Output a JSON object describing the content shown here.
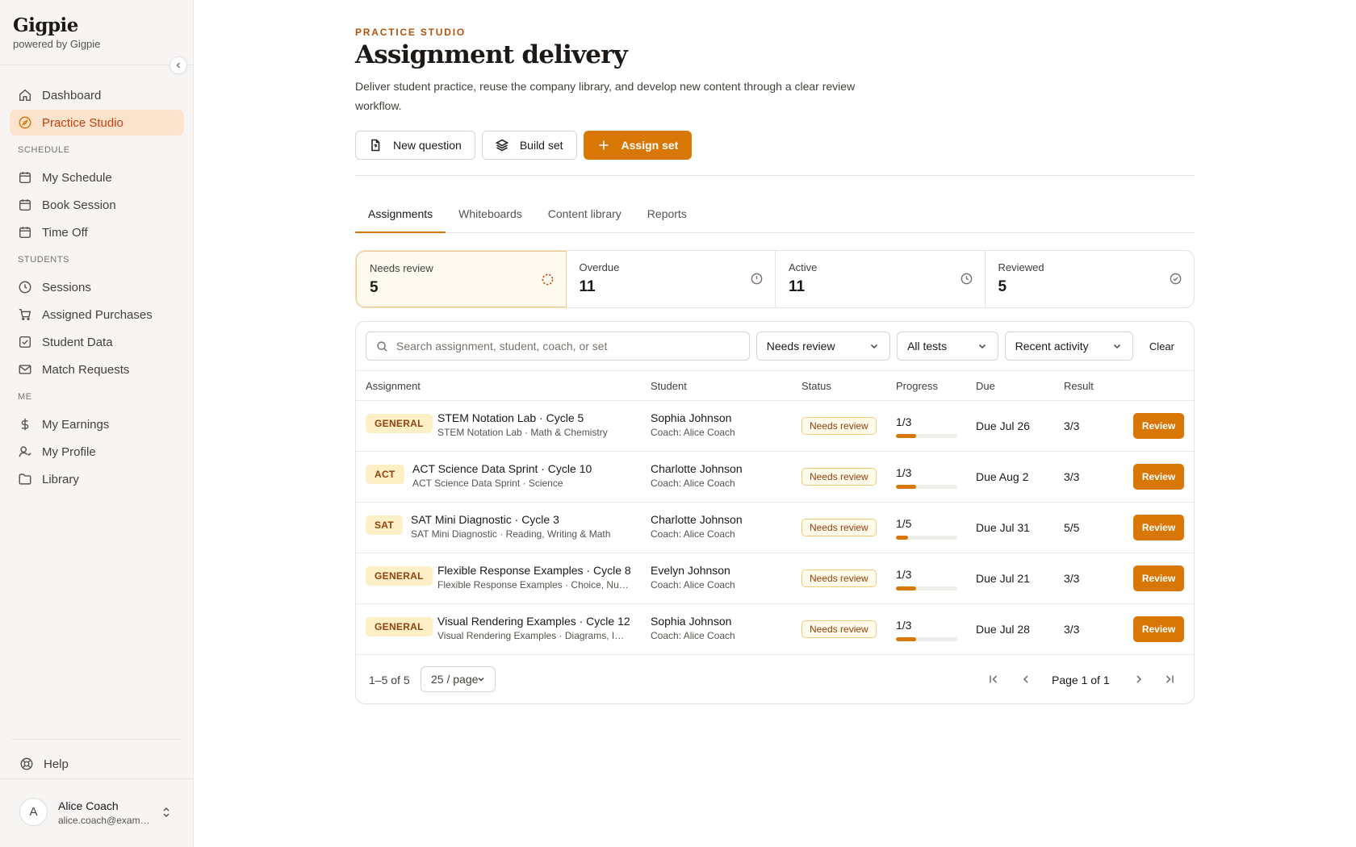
{
  "brand": {
    "name": "Gigpie",
    "sub": "powered by Gigpie"
  },
  "nav": {
    "dashboard": "Dashboard",
    "practice_studio": "Practice Studio",
    "schedule_section": "SCHEDULE",
    "my_schedule": "My Schedule",
    "book_session": "Book Session",
    "time_off": "Time Off",
    "students_section": "STUDENTS",
    "sessions": "Sessions",
    "assigned_purchases": "Assigned Purchases",
    "student_data": "Student Data",
    "match_requests": "Match Requests",
    "me_section": "ME",
    "my_earnings": "My Earnings",
    "my_profile": "My Profile",
    "library": "Library",
    "help": "Help"
  },
  "user": {
    "initial": "A",
    "name": "Alice Coach",
    "email": "alice.coach@example.com"
  },
  "header": {
    "eyebrow": "PRACTICE STUDIO",
    "title": "Assignment delivery",
    "description": "Deliver student practice, reuse the company library, and develop new content through a clear review workflow."
  },
  "actions": {
    "new_question": "New question",
    "build_set": "Build set",
    "assign_set": "Assign set"
  },
  "tabs": [
    "Assignments",
    "Whiteboards",
    "Content library",
    "Reports"
  ],
  "stats": [
    {
      "label": "Needs review",
      "value": "5",
      "icon": "dashed-circle-icon"
    },
    {
      "label": "Overdue",
      "value": "11",
      "icon": "alert-circle-icon"
    },
    {
      "label": "Active",
      "value": "11",
      "icon": "clock-icon"
    },
    {
      "label": "Reviewed",
      "value": "5",
      "icon": "check-circle-icon"
    }
  ],
  "filters": {
    "search_placeholder": "Search assignment, student, coach, or set",
    "status": "Needs review",
    "tests": "All tests",
    "sort": "Recent activity",
    "clear": "Clear"
  },
  "table": {
    "headers": {
      "assignment": "Assignment",
      "student": "Student",
      "status": "Status",
      "progress": "Progress",
      "due": "Due",
      "result": "Result"
    },
    "rows": [
      {
        "type": "GENERAL",
        "title": "STEM Notation Lab · Cycle 5",
        "subtitle": "STEM Notation Lab · Math & Chemistry",
        "student": "Sophia Johnson",
        "coach": "Coach: Alice Coach",
        "status": "Needs review",
        "progress": "1/3",
        "progress_fraction": 0.33,
        "due": "Due Jul 26",
        "result": "3/3",
        "action": "Review"
      },
      {
        "type": "ACT",
        "title": "ACT Science Data Sprint · Cycle 10",
        "subtitle": "ACT Science Data Sprint · Science",
        "student": "Charlotte Johnson",
        "coach": "Coach: Alice Coach",
        "status": "Needs review",
        "progress": "1/3",
        "progress_fraction": 0.33,
        "due": "Due Aug 2",
        "result": "3/3",
        "action": "Review"
      },
      {
        "type": "SAT",
        "title": "SAT Mini Diagnostic · Cycle 3",
        "subtitle": "SAT Mini Diagnostic · Reading, Writing & Math",
        "student": "Charlotte Johnson",
        "coach": "Coach: Alice Coach",
        "status": "Needs review",
        "progress": "1/5",
        "progress_fraction": 0.2,
        "due": "Due Jul 31",
        "result": "5/5",
        "action": "Review"
      },
      {
        "type": "GENERAL",
        "title": "Flexible Response Examples · Cycle 8",
        "subtitle": "Flexible Response Examples · Choice, Numeric & Text",
        "student": "Evelyn Johnson",
        "coach": "Coach: Alice Coach",
        "status": "Needs review",
        "progress": "1/3",
        "progress_fraction": 0.33,
        "due": "Due Jul 21",
        "result": "3/3",
        "action": "Review"
      },
      {
        "type": "GENERAL",
        "title": "Visual Rendering Examples · Cycle 12",
        "subtitle": "Visual Rendering Examples · Diagrams, Images",
        "student": "Sophia Johnson",
        "coach": "Coach: Alice Coach",
        "status": "Needs review",
        "progress": "1/3",
        "progress_fraction": 0.33,
        "due": "Due Jul 28",
        "result": "3/3",
        "action": "Review"
      }
    ]
  },
  "pagination": {
    "range": "1–5 of 5",
    "per_page": "25 / page",
    "page_label": "Page 1 of 1"
  },
  "colors": {
    "accent": "#d97706",
    "active_nav_bg": "#fbe3cd",
    "badge_bg": "#fdefc6"
  }
}
